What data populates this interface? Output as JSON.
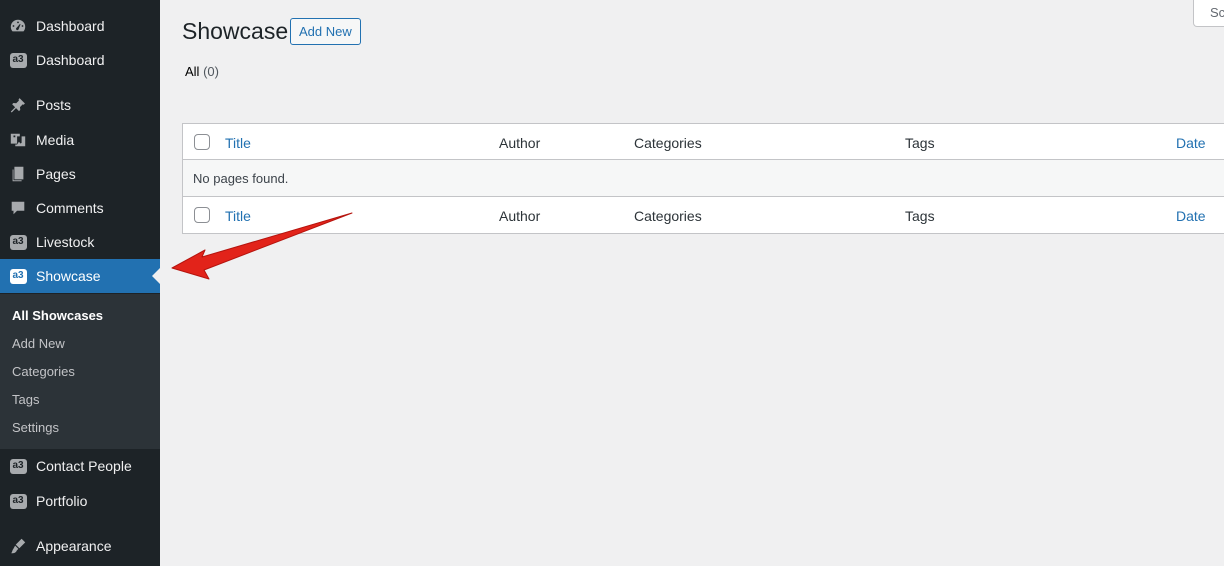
{
  "sidebar": {
    "items": [
      {
        "label": "Dashboard",
        "icon": "dashboard-icon"
      },
      {
        "label": "Dashboard",
        "icon": "a3-icon"
      },
      {
        "label": "Posts",
        "icon": "pin-icon"
      },
      {
        "label": "Media",
        "icon": "media-icon"
      },
      {
        "label": "Pages",
        "icon": "pages-icon"
      },
      {
        "label": "Comments",
        "icon": "comment-icon"
      },
      {
        "label": "Livestock",
        "icon": "a3-icon"
      },
      {
        "label": "Showcase",
        "icon": "a3-icon",
        "active": true
      },
      {
        "label": "Contact People",
        "icon": "a3-icon"
      },
      {
        "label": "Portfolio",
        "icon": "a3-icon"
      },
      {
        "label": "Appearance",
        "icon": "brush-icon"
      }
    ],
    "a3_text": "a3",
    "submenu": [
      "All Showcases",
      "Add New",
      "Categories",
      "Tags",
      "Settings"
    ]
  },
  "header": {
    "title": "Showcase",
    "add_new": "Add New",
    "screen_options": "Screen Options"
  },
  "filter": {
    "all_label": "All",
    "all_count": "(0)"
  },
  "table": {
    "columns": {
      "title": "Title",
      "author": "Author",
      "categories": "Categories",
      "tags": "Tags",
      "date": "Date"
    },
    "empty_message": "No pages found."
  },
  "colors": {
    "sidebar_bg": "#1d2327",
    "active_bg": "#2271b1",
    "arrow": "#e2231a"
  }
}
